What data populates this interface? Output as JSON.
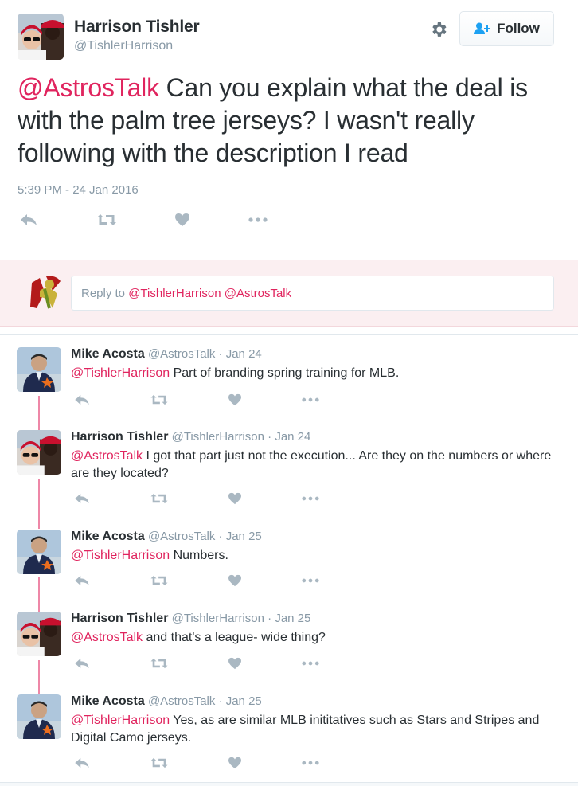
{
  "tweet": {
    "author_name": "Harrison Tishler",
    "author_handle": "@TishlerHarrison",
    "follow_label": "Follow",
    "text_mention": "@AstrosTalk",
    "text_body": " Can you explain what the deal is with the palm tree jerseys? I wasn't really following with the description I read",
    "timestamp": "5:39 PM - 24 Jan 2016",
    "icons": [
      "reply-icon",
      "retweet-icon",
      "like-icon",
      "more-icon"
    ]
  },
  "reply_box": {
    "prefix": "Reply to ",
    "mentions": "@TishlerHarrison @AstrosTalk"
  },
  "replies": [
    {
      "name": "Mike Acosta",
      "handle": "@AstrosTalk",
      "dot": "·",
      "date": "Jan 24",
      "mention": "@TishlerHarrison",
      "text": " Part of branding spring training for MLB."
    },
    {
      "name": "Harrison Tishler",
      "handle": "@TishlerHarrison",
      "dot": "·",
      "date": "Jan 24",
      "mention": "@AstrosTalk",
      "text": " I got that part just not the execution... Are they on the numbers or where are they located?"
    },
    {
      "name": "Mike Acosta",
      "handle": "@AstrosTalk",
      "dot": "·",
      "date": "Jan 25",
      "mention": "@TishlerHarrison",
      "text": " Numbers."
    },
    {
      "name": "Harrison Tishler",
      "handle": "@TishlerHarrison",
      "dot": "·",
      "date": "Jan 25",
      "mention": "@AstrosTalk",
      "text": " and that's a league- wide thing?"
    },
    {
      "name": "Mike Acosta",
      "handle": "@AstrosTalk",
      "dot": "·",
      "date": "Jan 25",
      "mention": "@TishlerHarrison",
      "text": " Yes, as are similar MLB inititatives such as Stars and Stripes and Digital Camo jerseys."
    }
  ],
  "colors": {
    "mention": "#e0245e",
    "muted": "#8899a6",
    "text": "#292f33",
    "reply_bg": "#fbeff1",
    "follow_icon": "#1da1f2"
  }
}
